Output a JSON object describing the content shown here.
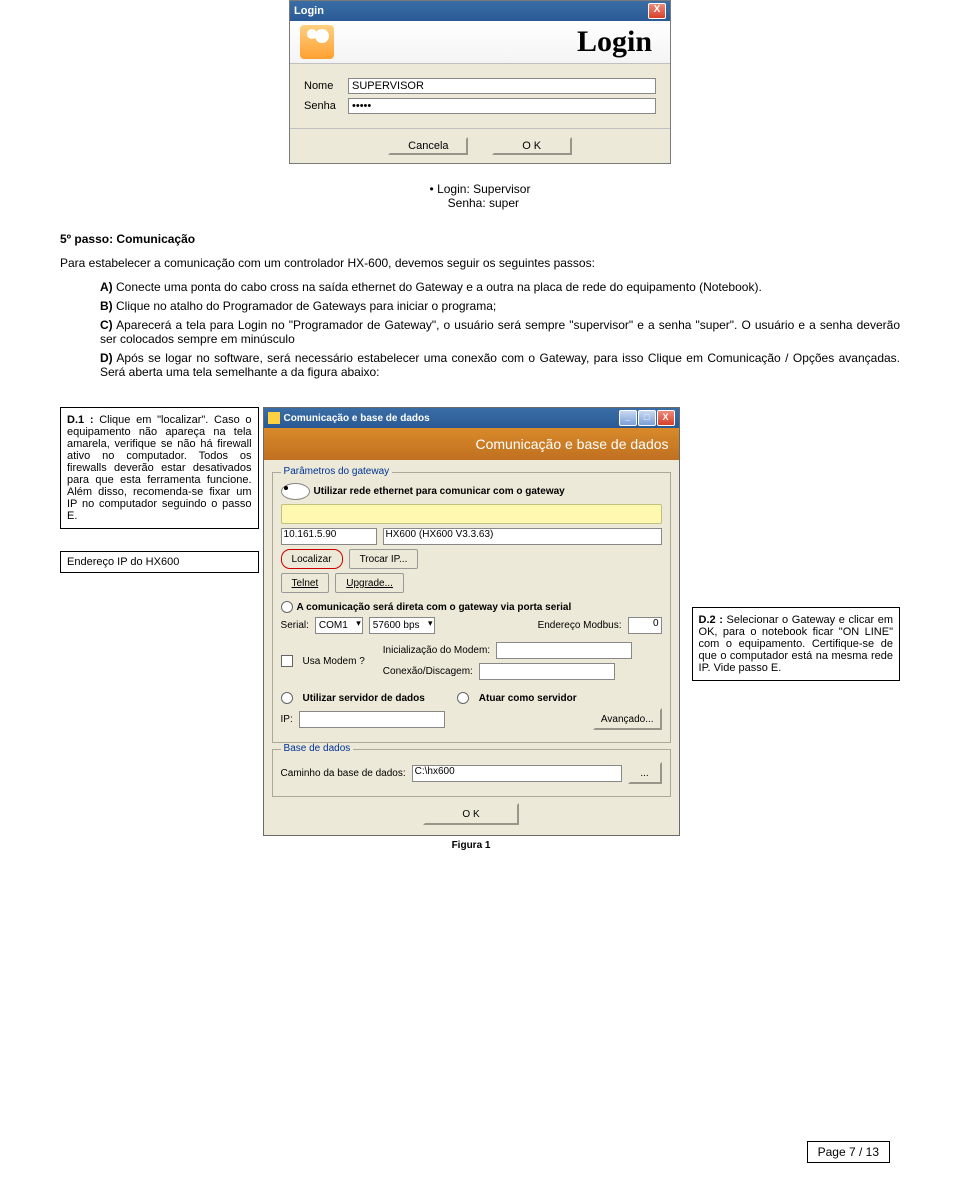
{
  "login_dialog": {
    "title": "Login",
    "banner_title": "Login",
    "name_label": "Nome",
    "name_value": "SUPERVISOR",
    "password_label": "Senha",
    "password_value": "•••••",
    "cancel": "Cancela",
    "ok": "O K"
  },
  "credentials": {
    "line1": "Login: Supervisor",
    "line2": "Senha: super"
  },
  "step5": {
    "heading": "5º passo: Comunicação",
    "intro": "Para estabelecer a comunicação com um controlador HX-600, devemos seguir os seguintes passos:",
    "items": {
      "a_label": "A)",
      "a_text": "Conecte uma ponta do cabo cross na saída ethernet do Gateway e a outra na placa de rede do equipamento (Notebook).",
      "b_label": "B)",
      "b_text": "Clique no atalho do Programador de Gateways para iniciar o programa;",
      "c_label": "C)",
      "c_text": "Aparecerá a tela para Login no \"Programador de Gateway\", o usuário será sempre \"supervisor\" e a senha \"super\". O usuário e a senha deverão ser colocados sempre em minúsculo",
      "d_label": "D)",
      "d_text": "Após se logar no software, será necessário estabelecer uma conexão com o Gateway, para isso Clique em Comunicação / Opções avançadas. Será aberta uma tela semelhante a da figura abaixo:"
    }
  },
  "d1": {
    "title": "D.1 :",
    "text": "Clique em \"localizar\". Caso o equipamento não apareça na tela amarela, verifique se não há firewall ativo no computador. Todos os firewalls deverão estar desativados para que esta ferramenta funcione. Além disso, recomenda-se fixar um IP no computador seguindo o passo E."
  },
  "ip_box": "Endereço IP do HX600",
  "d2": {
    "title": "D.2 :",
    "text": "Selecionar o Gateway e clicar em OK, para o notebook ficar \"ON LINE\" com o equipamento. Certifique-se de que o computador está na mesma rede IP. Vide passo E."
  },
  "comm": {
    "title": "Comunicação e base de dados",
    "banner": "Comunicação e base de dados",
    "params_legend": "Parâmetros do gateway",
    "radio_eth": "Utilizar rede ethernet para comunicar com o gateway",
    "ip_value": "10.161.5.90",
    "device_value": "HX600 (HX600 V3.3.63)",
    "btn_localizar": "Localizar",
    "btn_trocar": "Trocar IP...",
    "btn_telnet": "Telnet",
    "btn_upgrade": "Upgrade...",
    "radio_serial": "A comunicação será direta com o gateway via porta serial",
    "serial_label": "Serial:",
    "serial_value": "COM1",
    "baud_value": "57600 bps",
    "modbus_label": "Endereço Modbus:",
    "modbus_value": "0",
    "usa_modem": "Usa Modem ?",
    "init_modem_label": "Inicialização do Modem:",
    "conexao_label": "Conexão/Discagem:",
    "radio_server_data": "Utilizar servidor de dados",
    "radio_server_act": "Atuar como servidor",
    "ip_label": "IP:",
    "btn_avancado": "Avançado...",
    "db_legend": "Base de dados",
    "db_label": "Caminho da base de dados:",
    "db_value": "C:\\hx600",
    "btn_browse": "...",
    "btn_ok": "O K",
    "figure": "Figura 1"
  },
  "page_number": "Page 7 / 13"
}
